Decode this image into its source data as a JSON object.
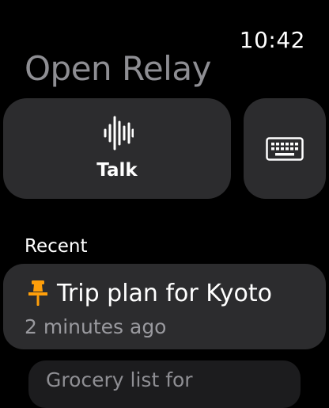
{
  "status_bar": {
    "time": "10:42"
  },
  "app": {
    "title": "Open Relay"
  },
  "actions": {
    "talk": {
      "label": "Talk",
      "icon": "waveform-icon"
    },
    "keyboard": {
      "icon": "keyboard-icon"
    }
  },
  "recent": {
    "header": "Recent",
    "items": [
      {
        "title": "Trip plan for Kyoto",
        "subtitle": "2 minutes ago",
        "pinned": true,
        "icon": "pin-icon"
      },
      {
        "title": "Grocery list for"
      }
    ]
  },
  "colors": {
    "background": "#000000",
    "card": "#2c2c2e",
    "title_gray": "#8e8e93",
    "pin_accent": "#ff9f0a"
  }
}
